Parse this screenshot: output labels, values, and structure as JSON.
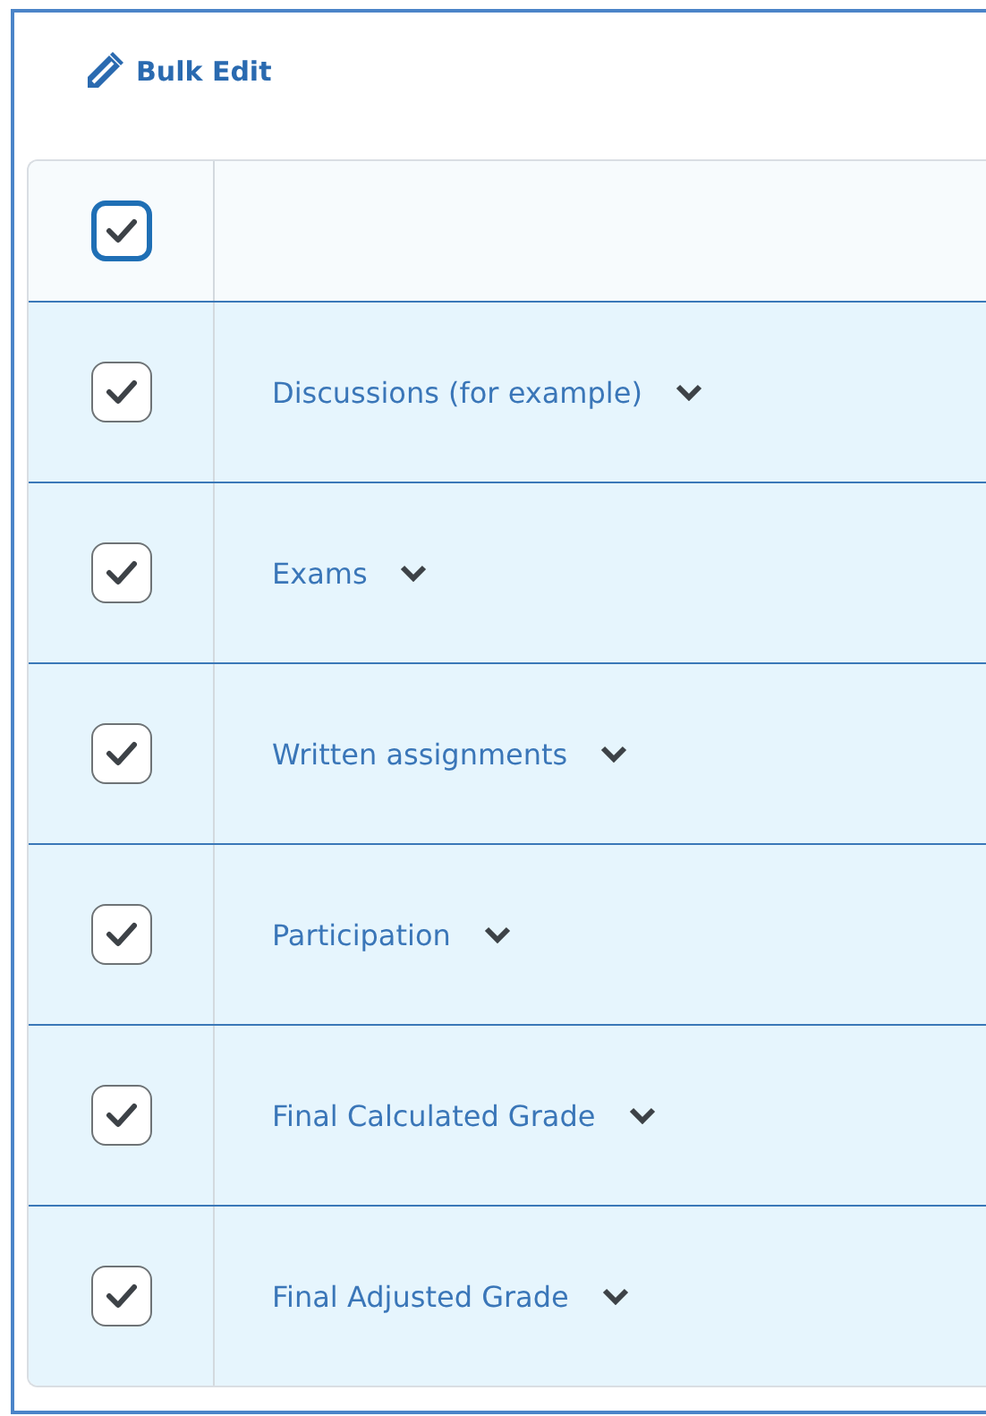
{
  "toolbar": {
    "bulk_edit": "Bulk Edit"
  },
  "table": {
    "select_all": {
      "checked": true
    },
    "rows": [
      {
        "label": "Discussions (for example)",
        "checked": true
      },
      {
        "label": "Exams",
        "checked": true
      },
      {
        "label": "Written assignments",
        "checked": true
      },
      {
        "label": "Participation",
        "checked": true
      },
      {
        "label": "Final Calculated Grade",
        "checked": true
      },
      {
        "label": "Final Adjusted Grade",
        "checked": true
      }
    ]
  }
}
